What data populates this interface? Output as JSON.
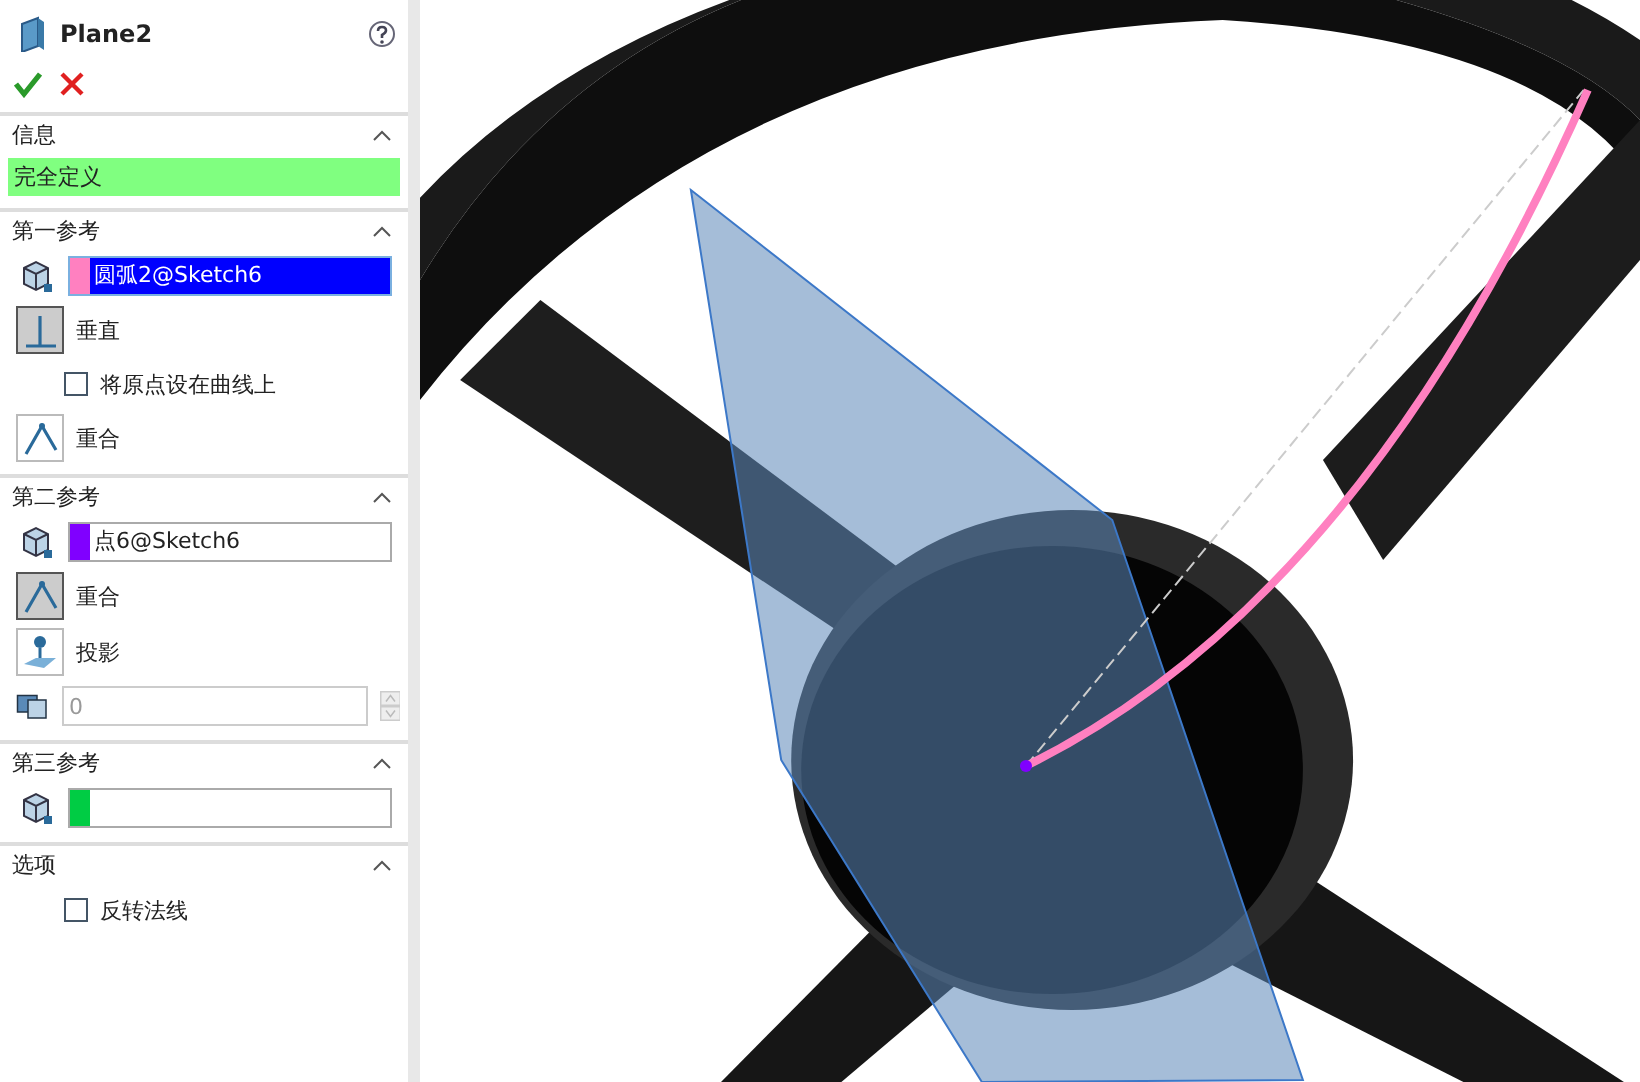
{
  "feature": {
    "title": "Plane2"
  },
  "sections": [
    {
      "title": "信息",
      "expanded": true,
      "items": [
        {
          "kind": "status",
          "text": "完全定义",
          "color": "#80ff80"
        }
      ]
    },
    {
      "title": "第一参考",
      "expanded": true,
      "items": [
        {
          "kind": "reference",
          "value": "圆弧2@Sketch6",
          "color": "#ff80c0",
          "selected": true
        },
        {
          "kind": "perpendicular",
          "label": "垂直",
          "selected": true
        },
        {
          "kind": "checkbox",
          "label": "将原点设在曲线上",
          "checked": false
        },
        {
          "kind": "coincident",
          "label": "重合",
          "selected": false
        }
      ]
    },
    {
      "title": "第二参考",
      "expanded": true,
      "items": [
        {
          "kind": "reference",
          "value": "点6@Sketch6",
          "color": "#8000ff",
          "selected": false
        },
        {
          "kind": "coincident",
          "label": "重合",
          "selected": true
        },
        {
          "kind": "project",
          "label": "投影",
          "selected": false
        },
        {
          "kind": "spin",
          "value": "0",
          "disabled": true
        }
      ]
    },
    {
      "title": "第三参考",
      "expanded": true,
      "items": [
        {
          "kind": "reference",
          "color": "#00cc44",
          "selected": false
        }
      ]
    },
    {
      "title": "选项",
      "expanded": true,
      "items": [
        {
          "kind": "checkbox",
          "label": "反转法线",
          "checked": false
        }
      ]
    }
  ]
}
